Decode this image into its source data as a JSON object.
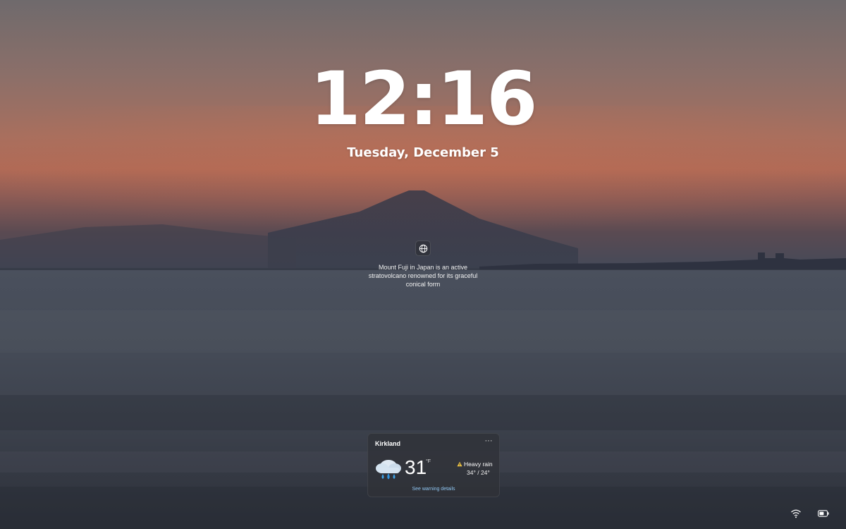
{
  "lockscreen": {
    "time": "12:16",
    "date": "Tuesday, December 5"
  },
  "spotlight": {
    "icon": "globe-icon",
    "caption": "Mount Fuji in Japan is an active stratovolcano renowned for its graceful conical form"
  },
  "weather": {
    "location": "Kirkland",
    "more_label": "···",
    "icon": "heavy-rain-icon",
    "temperature": "31",
    "unit": "°F",
    "warning_icon": "warning-icon",
    "condition": "Heavy rain",
    "range": "34° / 24°",
    "link": "See warning details"
  },
  "tray": {
    "wifi_icon": "wifi-icon",
    "battery_icon": "battery-icon"
  },
  "colors": {
    "accent_link": "#8fc6f2",
    "warning": "#f2c744"
  }
}
